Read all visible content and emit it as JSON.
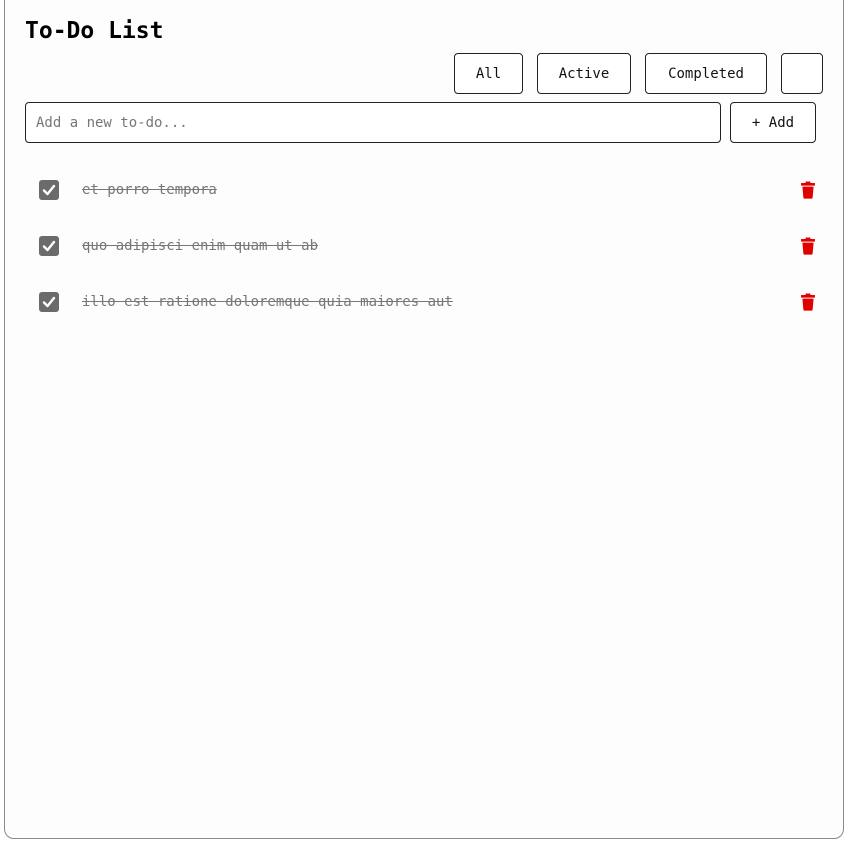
{
  "app": {
    "title": "To-Do List"
  },
  "filters": {
    "all_label": "All",
    "active_label": "Active",
    "completed_label": "Completed",
    "theme_label": ""
  },
  "new_todo": {
    "placeholder": "Add a new to-do...",
    "value": "",
    "add_label": "+ Add"
  },
  "todos": [
    {
      "text": "et porro tempora",
      "completed": true
    },
    {
      "text": "quo adipisci enim quam ut ab",
      "completed": true
    },
    {
      "text": "illo est ratione doloremque quia maiores aut",
      "completed": true
    }
  ],
  "icons": {
    "check": "check-icon",
    "delete": "trash-icon"
  },
  "colors": {
    "delete": "#e00000",
    "checkbox": "#6b6b6b",
    "completed_text": "#777777"
  }
}
